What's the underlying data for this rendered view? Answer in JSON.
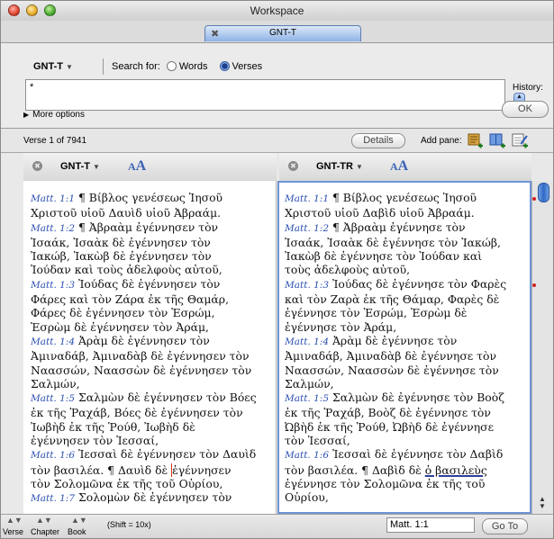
{
  "window": {
    "title": "Workspace"
  },
  "tab": {
    "label": "GNT-T"
  },
  "search": {
    "library": "GNT-T",
    "search_for_label": "Search for:",
    "option_words": "Words",
    "option_verses": "Verses",
    "selected": "Verses",
    "query": "*",
    "history_label": "History:",
    "ok_label": "OK",
    "more_options": "More options"
  },
  "verse_bar": {
    "count": "Verse 1  of 7941",
    "details_label": "Details",
    "add_pane_label": "Add pane:"
  },
  "panes": [
    {
      "library": "GNT-T",
      "lines": [
        [
          {
            "r": "Matt. 1:1"
          },
          {
            "t": " ¶    Βίβλος γενέσεως Ἰησοῦ"
          }
        ],
        [
          {
            "t": "Χριστοῦ υἱοῦ Δαυὶδ υἱοῦ Ἀβραάμ."
          }
        ],
        [
          {
            "r": "Matt. 1:2"
          },
          {
            "t": " ¶    Ἀβραὰμ ἐγέννησεν τὸν"
          }
        ],
        [
          {
            "t": "Ἰσαάκ, Ἰσαὰκ δὲ ἐγέννησεν τὸν"
          }
        ],
        [
          {
            "t": "Ἰακώβ, Ἰακὼβ δὲ ἐγέννησεν τὸν"
          }
        ],
        [
          {
            "t": "Ἰούδαν καὶ τοὺς ἀδελφοὺς αὐτοῦ,"
          }
        ],
        [
          {
            "r": "Matt. 1:3"
          },
          {
            "t": " Ἰούδας δὲ ἐγέννησεν τὸν"
          }
        ],
        [
          {
            "t": "Φάρες καὶ τὸν Ζάρα ἐκ τῆς Θαμάρ,"
          }
        ],
        [
          {
            "t": "Φάρες δὲ ἐγέννησεν τὸν Ἑσρώμ,"
          }
        ],
        [
          {
            "t": "Ἑσρὼμ δὲ ἐγέννησεν τὸν Ἀράμ,"
          }
        ],
        [
          {
            "r": "Matt. 1:4"
          },
          {
            "t": " Ἀρὰμ δὲ ἐγέννησεν τὸν"
          }
        ],
        [
          {
            "t": "Ἀμιναδάβ, Ἀμιναδὰβ δὲ ἐγέννησεν τὸν"
          }
        ],
        [
          {
            "t": "Ναασσών, Ναασσὼν δὲ ἐγέννησεν τὸν"
          }
        ],
        [
          {
            "t": "Σαλμών,"
          }
        ],
        [
          {
            "r": "Matt. 1:5"
          },
          {
            "t": " Σαλμὼν δὲ ἐγέννησεν τὸν Βόες"
          }
        ],
        [
          {
            "t": "ἐκ τῆς Ῥαχάβ, Βόες δὲ ἐγέννησεν τὸν"
          }
        ],
        [
          {
            "t": "Ἰωβὴδ ἐκ τῆς Ῥούθ, Ἰωβὴδ δὲ"
          }
        ],
        [
          {
            "t": "ἐγέννησεν τὸν Ἰεσσαί,"
          }
        ],
        [
          {
            "r": "Matt. 1:6"
          },
          {
            "t": " Ἰεσσαὶ δὲ ἐγέννησεν τὸν Δαυὶδ"
          }
        ],
        [
          {
            "t": "τὸν βασιλέα.  ¶   Δαυὶδ δὲ "
          },
          {
            "c": "ἐγέννησεν"
          }
        ],
        [
          {
            "t": "τὸν Σολομῶνα ἐκ τῆς τοῦ Οὐρίου,"
          }
        ],
        [
          {
            "r": "Matt. 1:7"
          },
          {
            "t": " Σολομὼν δὲ ἐγέννησεν τὸν"
          }
        ]
      ]
    },
    {
      "library": "GNT-TR",
      "lines": [
        [
          {
            "r": "Matt. 1:1"
          },
          {
            "t": " ¶ Βίβλος γενέσεως Ἰησοῦ"
          }
        ],
        [
          {
            "t": "Χριστοῦ υἱοῦ Δαβὶδ υἱοῦ Ἀβραάμ."
          }
        ],
        [
          {
            "r": "Matt. 1:2"
          },
          {
            "t": " ¶ Ἀβραὰμ ἐγέννησε τὸν"
          }
        ],
        [
          {
            "t": "Ἰσαάκ, Ἰσαὰκ δὲ ἐγέννησε τὸν Ἰακώβ,"
          }
        ],
        [
          {
            "t": "Ἰακὼβ δὲ ἐγέννησε τὸν Ἰούδαν καὶ"
          }
        ],
        [
          {
            "t": "τοὺς ἀδελφοὺς αὐτοῦ,"
          }
        ],
        [
          {
            "r": "Matt. 1:3"
          },
          {
            "t": " Ἰούδας δὲ ἐγέννησε τὸν Φαρὲς"
          }
        ],
        [
          {
            "t": "καὶ τὸν Ζαρὰ ἐκ τῆς Θάμαρ, Φαρὲς δὲ"
          }
        ],
        [
          {
            "t": "ἐγέννησε τὸν Ἐσρώμ, Ἐσρὼμ δὲ"
          }
        ],
        [
          {
            "t": "ἐγέννησε τὸν Ἀράμ,"
          }
        ],
        [
          {
            "r": "Matt. 1:4"
          },
          {
            "t": " Ἀρὰμ δὲ ἐγέννησε τὸν"
          }
        ],
        [
          {
            "t": "Ἀμιναδάβ, Ἀμιναδὰβ δὲ ἐγέννησε τὸν"
          }
        ],
        [
          {
            "t": "Ναασσών, Ναασσὼν δὲ ἐγέννησε τὸν"
          }
        ],
        [
          {
            "t": "Σαλμών,"
          }
        ],
        [
          {
            "r": "Matt. 1:5"
          },
          {
            "t": " Σαλμὼν δὲ ἐγέννησε τὸν Βοὸζ"
          }
        ],
        [
          {
            "t": "ἐκ τῆς Ῥαχάβ, Βοὸζ δὲ ἐγέννησε τὸν"
          }
        ],
        [
          {
            "t": "Ὠβὴδ ἐκ τῆς Ῥούθ, Ὠβὴδ δὲ ἐγέννησε"
          }
        ],
        [
          {
            "t": "τὸν Ἰεσσαί,"
          }
        ],
        [
          {
            "r": "Matt. 1:6"
          },
          {
            "t": " Ἰεσσαὶ δὲ ἐγέννησε τὸν Δαβὶδ"
          }
        ],
        [
          {
            "t": "τὸν βασιλέα.  ¶ Δαβὶδ δὲ "
          },
          {
            "h": "ὁ βασιλεὺς"
          }
        ],
        [
          {
            "t": "ἐγέννησε τὸν Σολομῶνα ἐκ τῆς τοῦ"
          }
        ],
        [
          {
            "t": "Οὐρίου,"
          }
        ]
      ]
    }
  ],
  "navigation": {
    "verse_label": "Verse",
    "chapter_label": "Chapter",
    "book_label": "Book",
    "shift_hint": "(Shift = 10x)",
    "goto_value": "Matt. 1:1",
    "goto_label": "Go To"
  },
  "colors": {
    "accent": "#3a63b5",
    "reference": "#2a4fb2",
    "highlight": "#2c3f9c"
  }
}
